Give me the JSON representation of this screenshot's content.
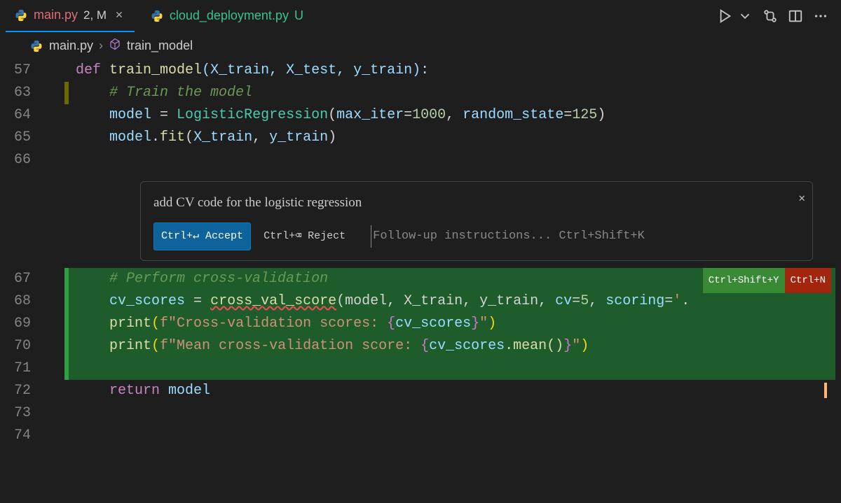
{
  "tabs": {
    "active": {
      "name": "main.py",
      "modified": "2, M"
    },
    "inactive": {
      "name": "cloud_deployment.py",
      "status": "U"
    }
  },
  "breadcrumb": {
    "file": "main.py",
    "symbol": "train_model"
  },
  "inline_suggest": {
    "prompt": "add CV code for the logistic regression",
    "accept_label": "Ctrl+↵ Accept",
    "reject_label": "Ctrl+⌫ Reject",
    "followup_placeholder": "Follow-up instructions... Ctrl+Shift+K",
    "badge_accept": "Ctrl+Shift+Y",
    "badge_new": "Ctrl+N"
  },
  "lines": {
    "l57": "57",
    "l63": "63",
    "l64": "64",
    "l65": "65",
    "l66": "66",
    "l67": "67",
    "l68": "68",
    "l69": "69",
    "l70": "70",
    "l71": "71",
    "l72": "72",
    "l73": "73",
    "l74": "74"
  },
  "tok": {
    "def": "def",
    "train_model": "train_model",
    "arglist": "(X_train, X_test, y_train):",
    "c_train": "# Train the model",
    "model": "model",
    "eq": " = ",
    "LR": "LogisticRegression",
    "lr_args_open": "(",
    "max_iter": "max_iter",
    "n1000": "1000",
    "rand": "random_state",
    "n125": "125",
    "close": ")",
    "fit": "model.fit(X_train, y_train)",
    "c_cv": "# Perform cross-validation",
    "cv_scores": "cv_scores",
    "cvs": "cross_val_score",
    "cv_args_a": "(model, X_train, y_train, ",
    "cv_arg": "cv",
    "n5": "5",
    "scoring": "scoring",
    "eq2": "=",
    "tail": "'",
    "print": "print",
    "fstr1a": "f\"Cross-validation scores: ",
    "fv1": "cv_scores",
    "fstr1b": "\"",
    "fstr2a": "f\"Mean cross-validation score: ",
    "fv2": "cv_scores",
    "mean": ".mean()",
    "fstr2b": "\"",
    "return": "return",
    "model2": " model",
    "comma": ", "
  }
}
